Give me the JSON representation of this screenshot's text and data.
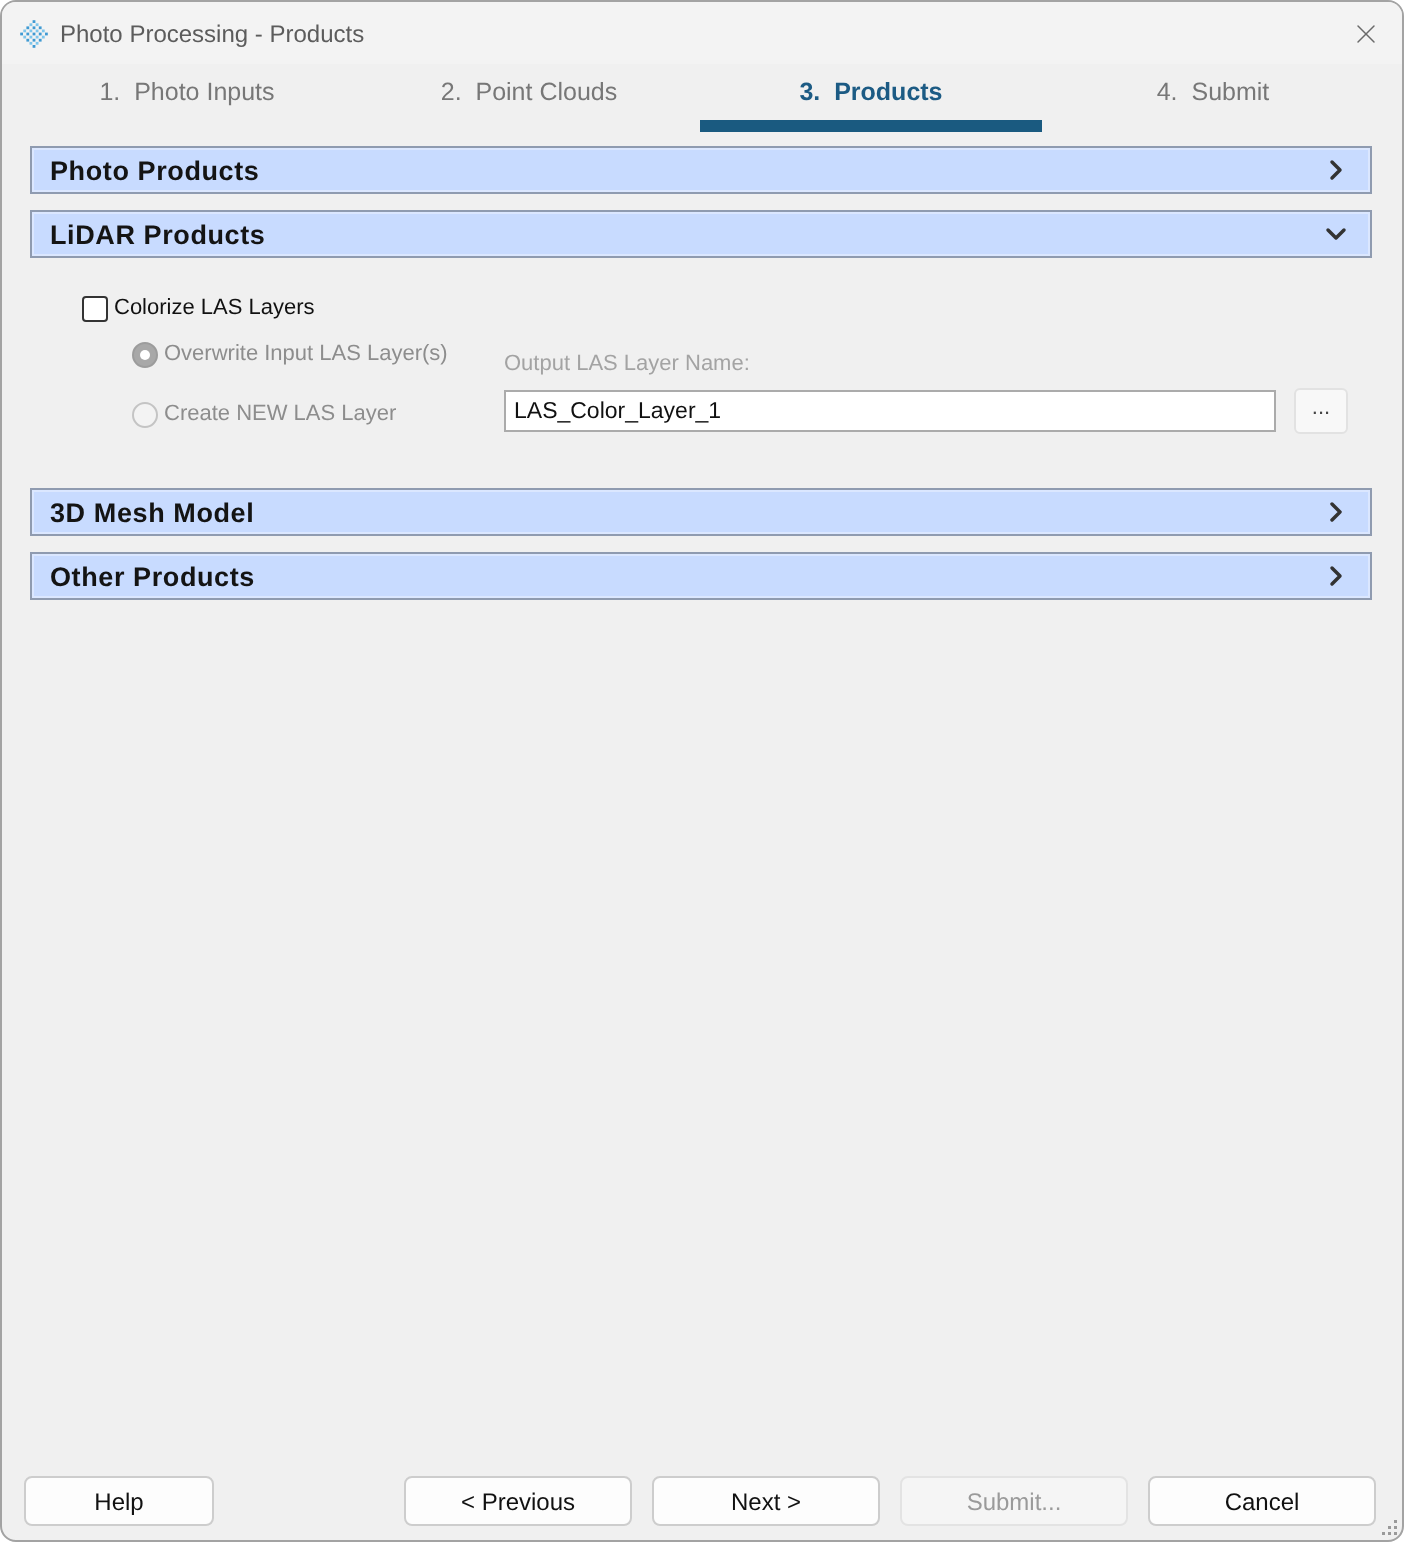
{
  "window": {
    "title": "Photo Processing - Products"
  },
  "tabs": [
    {
      "label": "1.  Photo Inputs",
      "selected": false
    },
    {
      "label": "2.  Point Clouds",
      "selected": false
    },
    {
      "label": "3.  Products",
      "selected": true
    },
    {
      "label": "4.  Submit",
      "selected": false
    }
  ],
  "sections": [
    {
      "title": "Photo Products",
      "expanded": false
    },
    {
      "title": "LiDAR Products",
      "expanded": true,
      "colorize": {
        "label": "Colorize LAS Layers",
        "checked": false
      },
      "layer_options": [
        {
          "label": "Overwrite Input LAS Layer(s)",
          "selected": true,
          "disabled": true
        },
        {
          "label": "Create NEW LAS Layer",
          "selected": false,
          "disabled": true
        }
      ],
      "output_name": {
        "label": "Output LAS Layer Name:",
        "value": "LAS_Color_Layer_1"
      },
      "browse_button": "..."
    },
    {
      "title": "3D Mesh Model",
      "expanded": false
    },
    {
      "title": "Other Products",
      "expanded": false
    }
  ],
  "buttons": [
    {
      "label": "Help",
      "disabled": false
    },
    {
      "label": "< Previous",
      "disabled": false
    },
    {
      "label": "Next >",
      "disabled": false
    },
    {
      "label": "Submit...",
      "disabled": true
    },
    {
      "label": "Cancel",
      "disabled": false
    }
  ]
}
